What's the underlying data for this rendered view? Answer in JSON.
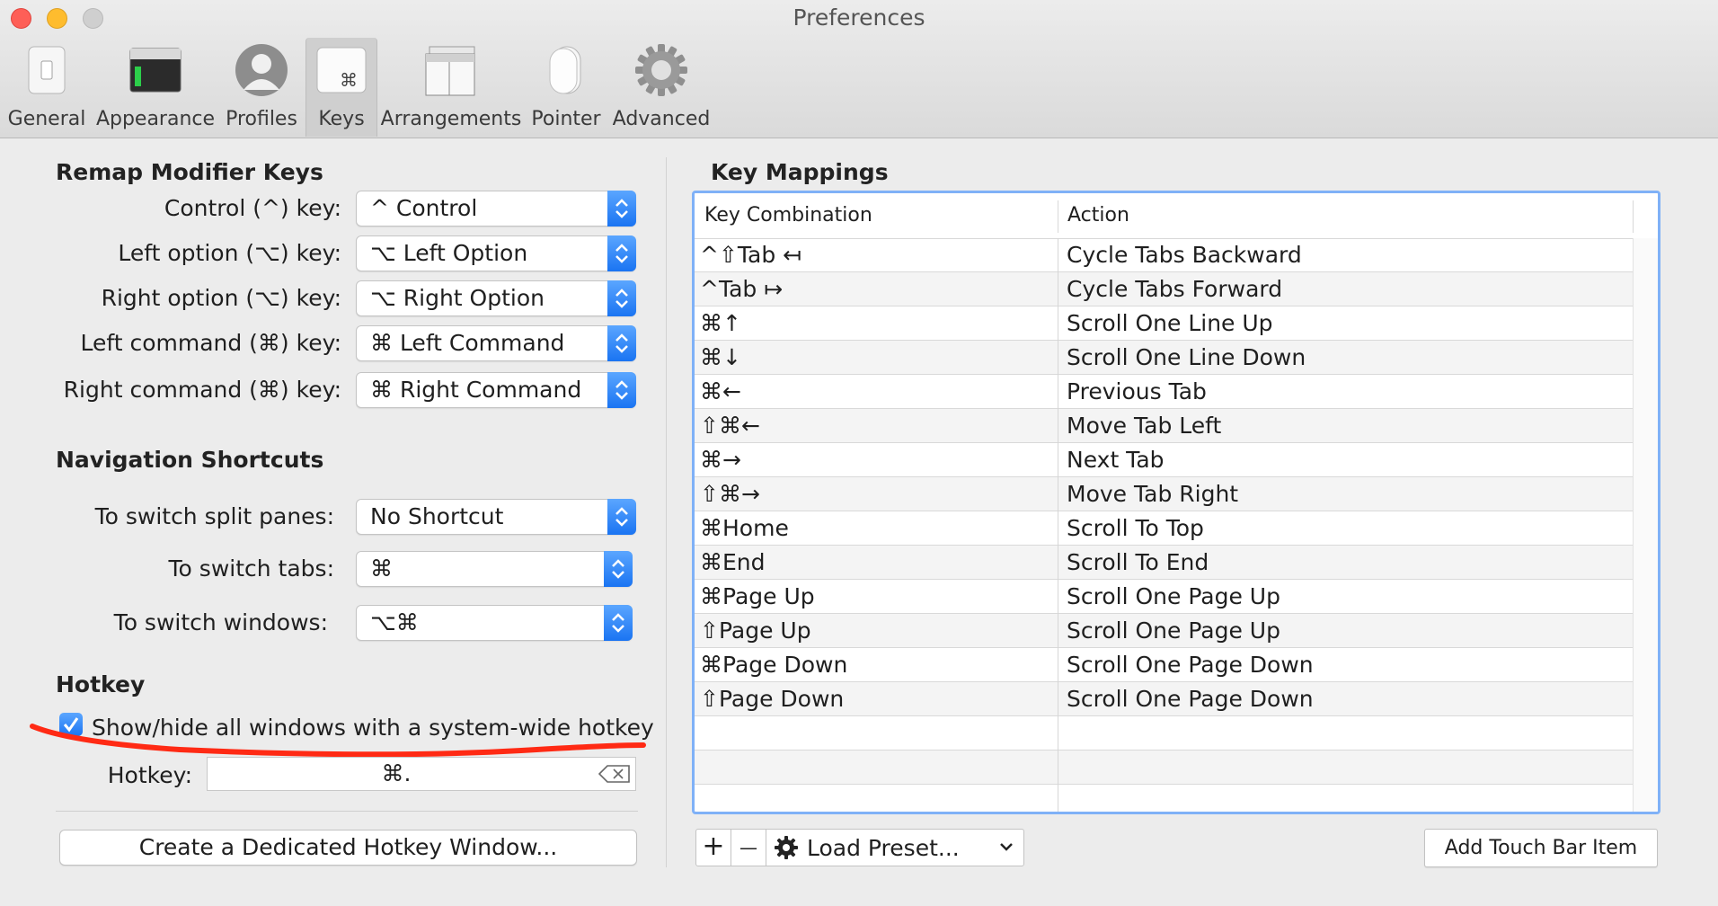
{
  "window": {
    "title": "Preferences"
  },
  "toolbar": [
    {
      "label": "General",
      "icon": "general-switch-icon"
    },
    {
      "label": "Appearance",
      "icon": "appearance-terminal-icon"
    },
    {
      "label": "Profiles",
      "icon": "profiles-user-icon"
    },
    {
      "label": "Keys",
      "icon": "keys-command-icon",
      "selected": true
    },
    {
      "label": "Arrangements",
      "icon": "arrangements-windows-icon"
    },
    {
      "label": "Pointer",
      "icon": "pointer-mouse-icon"
    },
    {
      "label": "Advanced",
      "icon": "advanced-gear-icon"
    }
  ],
  "remap": {
    "title": "Remap Modifier Keys",
    "rows": [
      {
        "label": "Control (^) key:",
        "value": "^ Control"
      },
      {
        "label": "Left option (⌥) key:",
        "value": "⌥ Left Option"
      },
      {
        "label": "Right option (⌥) key:",
        "value": "⌥ Right Option"
      },
      {
        "label": "Left command (⌘) key:",
        "value": "⌘ Left Command"
      },
      {
        "label": "Right command (⌘) key:",
        "value": "⌘ Right Command"
      }
    ]
  },
  "navigation": {
    "title": "Navigation Shortcuts",
    "rows": [
      {
        "label": "To switch split panes:",
        "value": "No Shortcut"
      },
      {
        "label": "To switch tabs:",
        "value": "⌘"
      },
      {
        "label": "To switch windows:",
        "value": "⌥⌘"
      }
    ]
  },
  "hotkey": {
    "title": "Hotkey",
    "checkbox_label": "Show/hide all windows with a system-wide hotkey",
    "checked": true,
    "field_label": "Hotkey:",
    "field_value": "⌘.",
    "dedicated_button": "Create a Dedicated Hotkey Window..."
  },
  "key_mappings": {
    "title": "Key Mappings",
    "columns": [
      "Key Combination",
      "Action"
    ],
    "rows": [
      {
        "key": "^⇧Tab ↤",
        "action": "Cycle Tabs Backward"
      },
      {
        "key": "^Tab ↦",
        "action": "Cycle Tabs Forward"
      },
      {
        "key": "⌘↑",
        "action": "Scroll One Line Up"
      },
      {
        "key": "⌘↓",
        "action": "Scroll One Line Down"
      },
      {
        "key": "⌘←",
        "action": "Previous Tab"
      },
      {
        "key": "⇧⌘←",
        "action": "Move Tab Left"
      },
      {
        "key": "⌘→",
        "action": "Next Tab"
      },
      {
        "key": "⇧⌘→",
        "action": "Move Tab Right"
      },
      {
        "key": "⌘Home",
        "action": "Scroll To Top"
      },
      {
        "key": "⌘End",
        "action": "Scroll To End"
      },
      {
        "key": "⌘Page Up",
        "action": "Scroll One Page Up"
      },
      {
        "key": "⇧Page Up",
        "action": "Scroll One Page Up"
      },
      {
        "key": "⌘Page Down",
        "action": "Scroll One Page Down"
      },
      {
        "key": "⇧Page Down",
        "action": "Scroll One Page Down"
      }
    ],
    "add_symbol": "+",
    "remove_symbol": "—",
    "load_preset": "Load Preset...",
    "touch_bar_button": "Add Touch Bar Item"
  }
}
